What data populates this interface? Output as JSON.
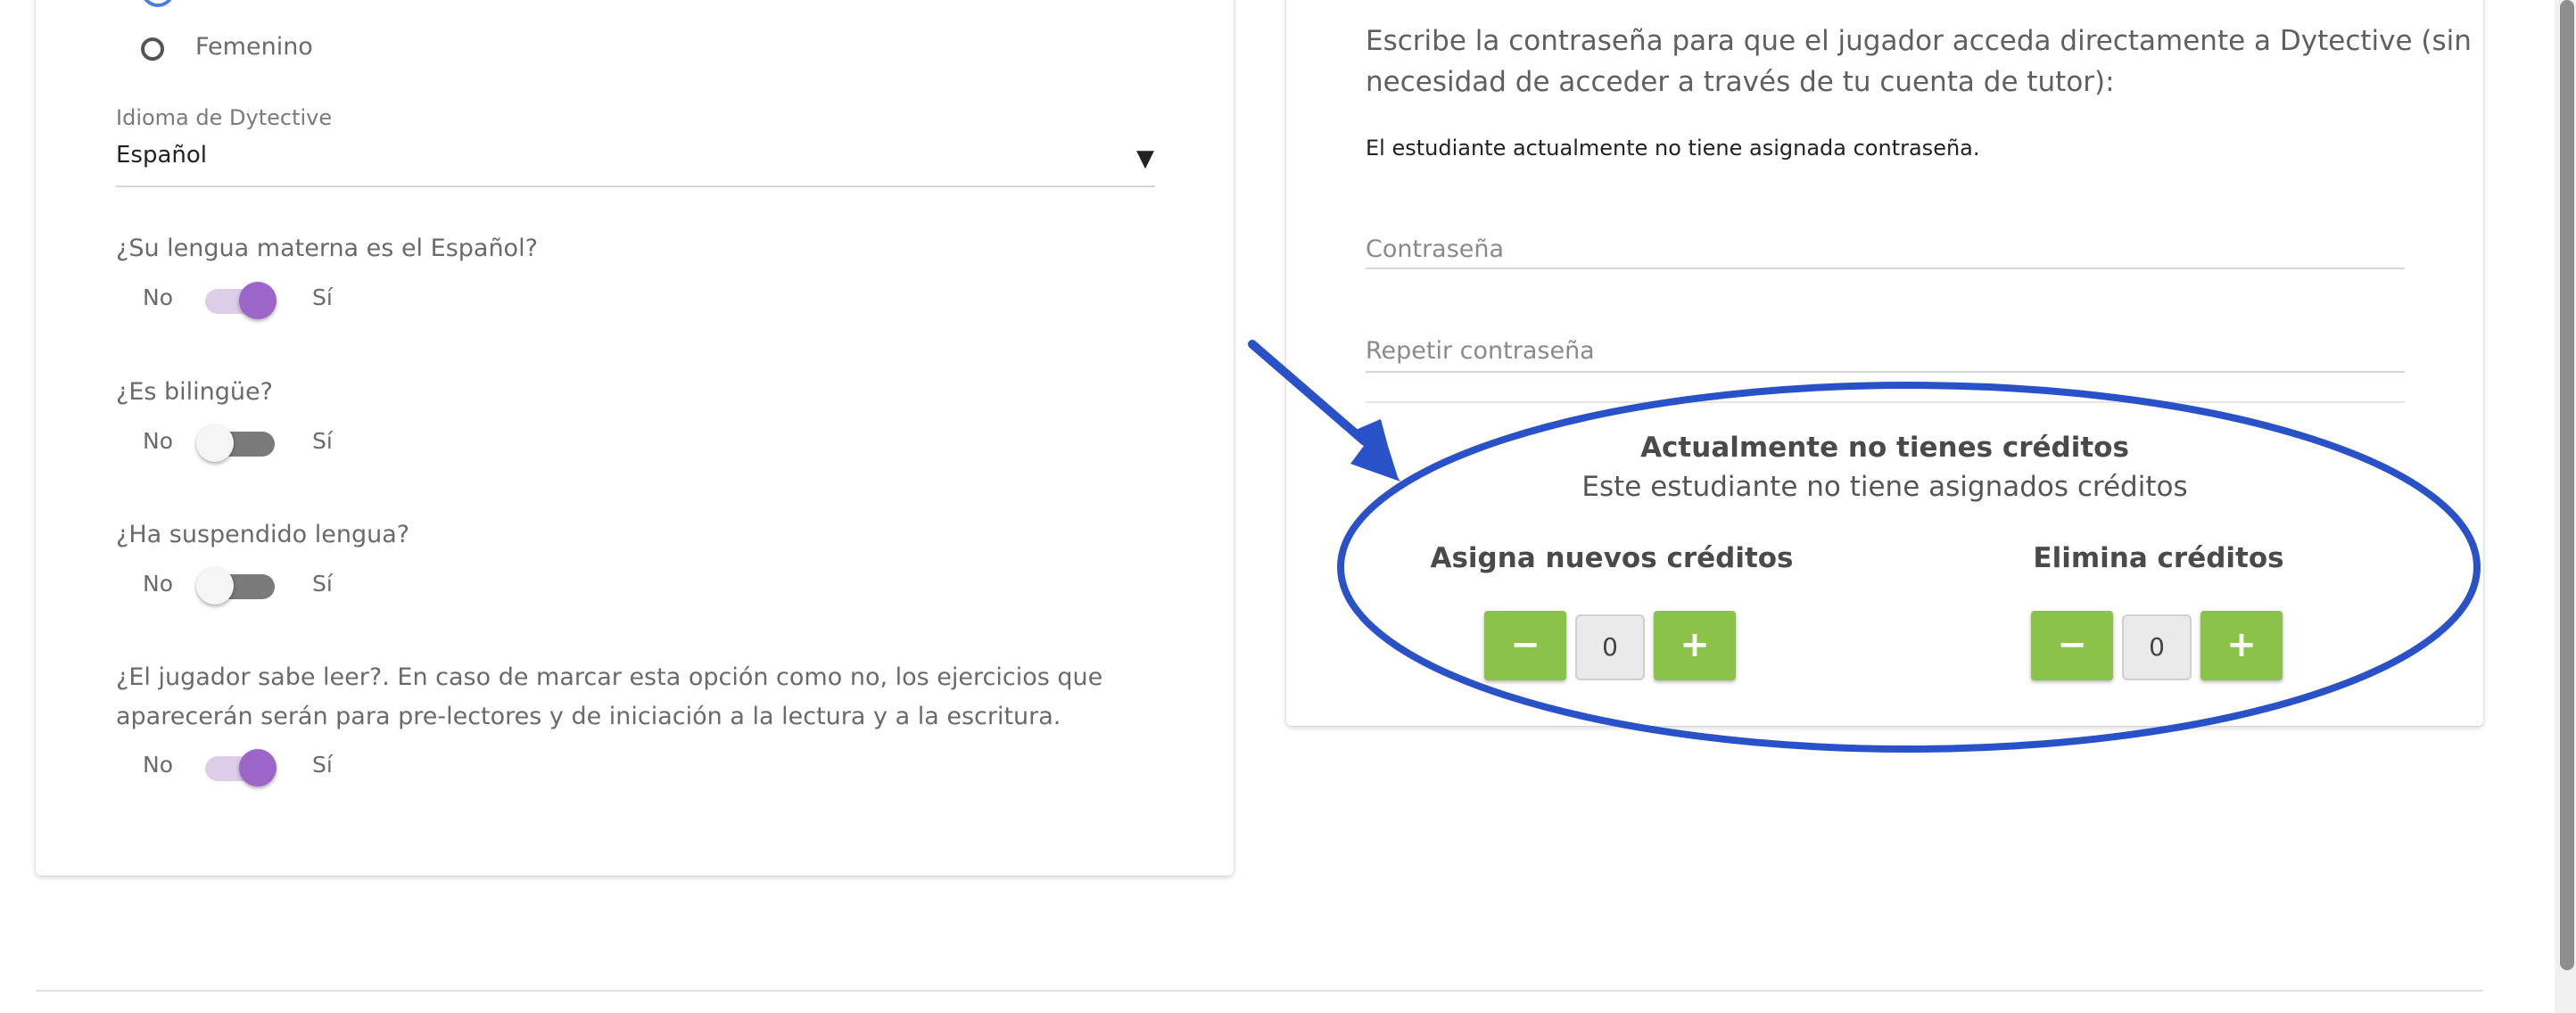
{
  "left_form": {
    "gender_option_female": "Femenino",
    "language_label": "Idioma de Dytective",
    "language_value": "Español",
    "questions": [
      {
        "label": "¿Su lengua materna es el Español?",
        "no": "No",
        "yes": "Sí",
        "state": "on"
      },
      {
        "label": "¿Es bilingüe?",
        "no": "No",
        "yes": "Sí",
        "state": "off"
      },
      {
        "label": "¿Ha suspendido lengua?",
        "no": "No",
        "yes": "Sí",
        "state": "off"
      }
    ],
    "reading_question_line1": "¿El jugador sabe leer?. En caso de marcar esta opción como no, los ejercicios que",
    "reading_question_line2": "aparecerán serán para pre-lectores y de iniciación a la lectura y a la escritura.",
    "reading_no": "No",
    "reading_yes": "Sí",
    "reading_state": "on"
  },
  "right_panel": {
    "password_intro_line1": "Escribe la contraseña para que el jugador acceda directamente a Dytective (sin",
    "password_intro_line2": "necesidad de acceder a través de tu cuenta de tutor):",
    "password_status": "El estudiante actualmente no tiene asignada contraseña.",
    "password_placeholder": "Contraseña",
    "repeat_password_placeholder": "Repetir contraseña",
    "credits_title": "Actualmente no tienes créditos",
    "credits_subtitle": "Este estudiante no tiene asignados créditos",
    "assign": {
      "label": "Asigna nuevos créditos",
      "minus": "−",
      "value": "0",
      "plus": "+"
    },
    "remove": {
      "label": "Elimina créditos",
      "minus": "−",
      "value": "0",
      "plus": "+"
    }
  },
  "colors": {
    "accent_purple": "#9c65c8",
    "credit_button_green": "#8bc34a",
    "annotation_blue": "#2a52c8"
  },
  "icons": {
    "dropdown": "triangle-down-icon",
    "annotation_arrow": "arrow-icon",
    "annotation_ellipse": "highlight-ellipse"
  }
}
